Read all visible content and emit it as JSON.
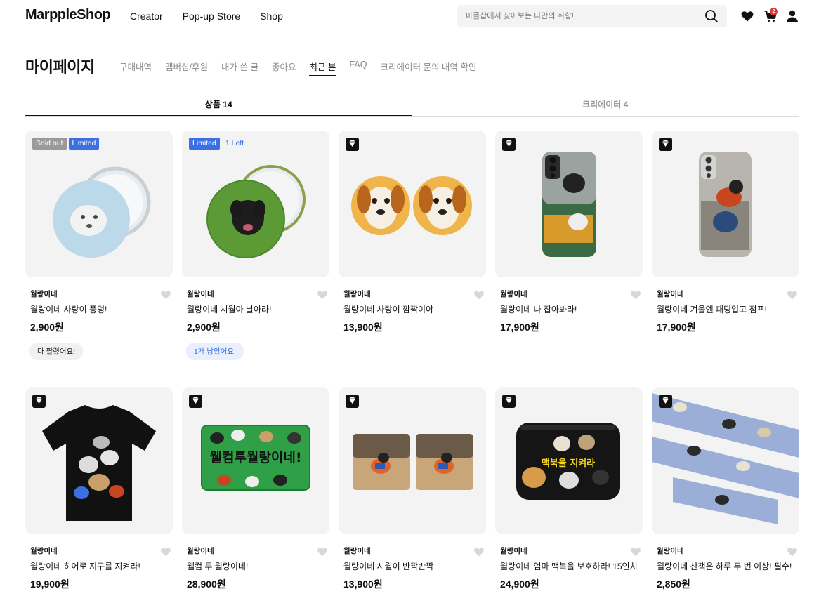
{
  "header": {
    "logo": "MarppleShop",
    "nav": [
      "Creator",
      "Pop-up Store",
      "Shop"
    ],
    "search_placeholder": "마플샵에서 찾아보는 나만의 취향!",
    "cart_count": "2"
  },
  "page": {
    "title": "마이페이지",
    "subnav": [
      "구매내역",
      "멤버십/후원",
      "내가 쓴 글",
      "좋아요",
      "최근 본",
      "FAQ",
      "크리에이터 문의 내역 확인"
    ],
    "active_subnav": "최근 본"
  },
  "tabs": [
    {
      "label": "상품 14",
      "active": true
    },
    {
      "label": "크리에이터 4",
      "active": false
    }
  ],
  "products": [
    {
      "creator": "월랑이네",
      "name": "월랑이네 사랑이 풍덩!",
      "price": "2,900원",
      "tags": [
        "Sold out",
        "Limited"
      ],
      "pill": "다 팔렸어요!",
      "pill_style": "gray",
      "art": "mirror-blue"
    },
    {
      "creator": "월랑이네",
      "name": "월랑이네 시월아 날아라!",
      "price": "2,900원",
      "tags": [
        "Limited",
        "1 Left"
      ],
      "pill": "1개 남았어요!",
      "pill_style": "blue",
      "art": "mirror-green"
    },
    {
      "creator": "월랑이네",
      "name": "월랑이네 사랑이 깜짝이야",
      "price": "13,900원",
      "tags": [],
      "art": "griptok"
    },
    {
      "creator": "월랑이네",
      "name": "월랑이네 나 잡아봐라!",
      "price": "17,900원",
      "tags": [],
      "art": "phone-green"
    },
    {
      "creator": "월랑이네",
      "name": "월랑이네 겨울엔 패딩입고 점프!",
      "price": "17,900원",
      "tags": [],
      "art": "phone-gray"
    },
    {
      "creator": "월랑이네",
      "name": "월랑이네 히어로 지구를 지켜라!",
      "price": "19,900원",
      "tags": [],
      "art": "tshirt"
    },
    {
      "creator": "월랑이네",
      "name": "웰컴 투 월랑이네!",
      "price": "28,900원",
      "tags": [],
      "art": "mat",
      "art_text": "웰컴투월랑이네!"
    },
    {
      "creator": "월랑이네",
      "name": "월랑이네 시월이 반짝반짝",
      "price": "13,900원",
      "tags": [],
      "art": "cards"
    },
    {
      "creator": "월랑이네",
      "name": "월랑이네 엄마 맥북을 보호하라! 15인치",
      "price": "24,900원",
      "tags": [],
      "art": "pouch",
      "art_text": "맥북을 지켜라"
    },
    {
      "creator": "월랑이네",
      "name": "월랑이네 산책은 하루 두 번 이상! 필수!",
      "price": "2,850원",
      "tags": [],
      "art": "tape"
    }
  ]
}
